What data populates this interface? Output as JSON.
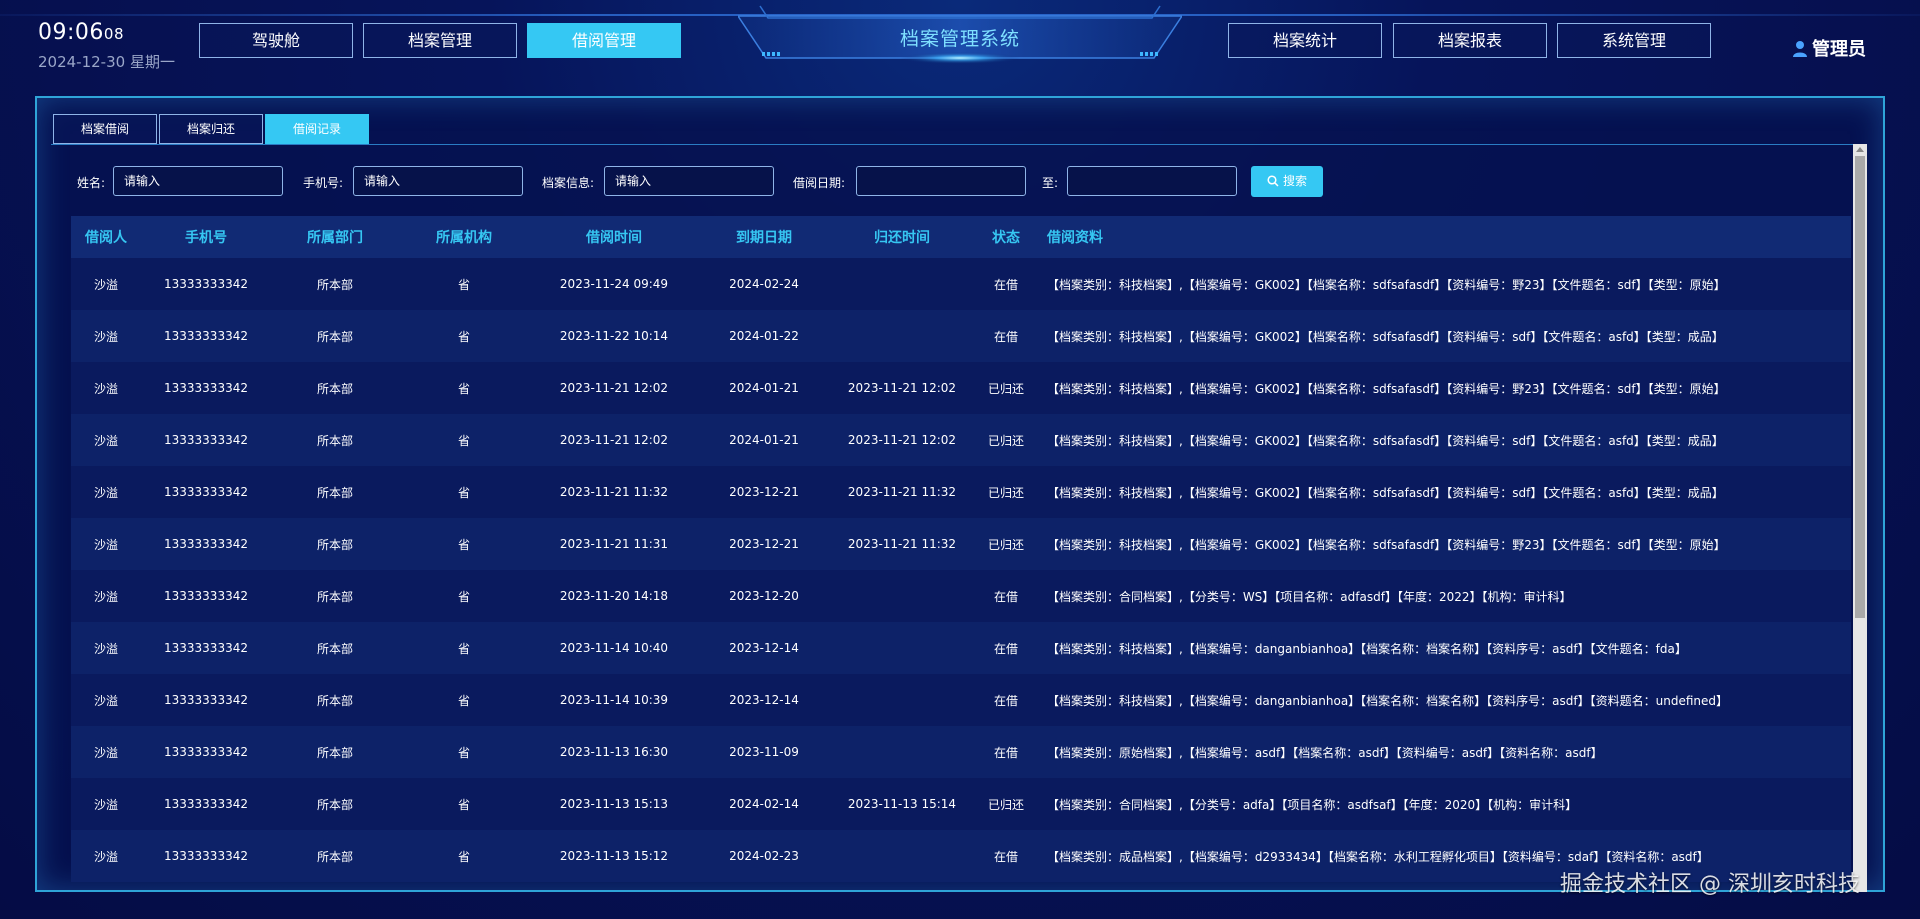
{
  "clock": {
    "time": "09:06",
    "seconds": "08",
    "date": "2024-12-30 星期一"
  },
  "nav_left": [
    {
      "label": "驾驶舱",
      "active": false
    },
    {
      "label": "档案管理",
      "active": false
    },
    {
      "label": "借阅管理",
      "active": true
    }
  ],
  "system_title": "档案管理系统",
  "nav_right": [
    {
      "label": "档案统计"
    },
    {
      "label": "档案报表"
    },
    {
      "label": "系统管理"
    }
  ],
  "user": {
    "name": "管理员",
    "icon": "user-icon"
  },
  "tabs": [
    {
      "label": "档案借阅",
      "active": false
    },
    {
      "label": "档案归还",
      "active": false
    },
    {
      "label": "借阅记录",
      "active": true
    }
  ],
  "filters": {
    "name_label": "姓名:",
    "name_placeholder": "请输入",
    "phone_label": "手机号:",
    "phone_placeholder": "请输入",
    "info_label": "档案信息:",
    "info_placeholder": "请输入",
    "date_label": "借阅日期:",
    "to_label": "至:",
    "search_label": "搜索",
    "search_icon": "search-icon"
  },
  "table": {
    "columns": [
      "借阅人",
      "手机号",
      "所属部门",
      "所属机构",
      "借阅时间",
      "到期日期",
      "归还时间",
      "状态",
      "借阅资料"
    ],
    "rows": [
      [
        "沙溢",
        "13333333342",
        "所本部",
        "省",
        "2023-11-24 09:49",
        "2024-02-24",
        "",
        "在借",
        "【档案类别：科技档案】,【档案编号：GK002】【档案名称：sdfsafasdf】【资料编号：野23】【文件题名：sdf】【类型：原始】"
      ],
      [
        "沙溢",
        "13333333342",
        "所本部",
        "省",
        "2023-11-22 10:14",
        "2024-01-22",
        "",
        "在借",
        "【档案类别：科技档案】,【档案编号：GK002】【档案名称：sdfsafasdf】【资料编号：sdf】【文件题名：asfd】【类型：成品】"
      ],
      [
        "沙溢",
        "13333333342",
        "所本部",
        "省",
        "2023-11-21 12:02",
        "2024-01-21",
        "2023-11-21 12:02",
        "已归还",
        "【档案类别：科技档案】,【档案编号：GK002】【档案名称：sdfsafasdf】【资料编号：野23】【文件题名：sdf】【类型：原始】"
      ],
      [
        "沙溢",
        "13333333342",
        "所本部",
        "省",
        "2023-11-21 12:02",
        "2024-01-21",
        "2023-11-21 12:02",
        "已归还",
        "【档案类别：科技档案】,【档案编号：GK002】【档案名称：sdfsafasdf】【资料编号：sdf】【文件题名：asfd】【类型：成品】"
      ],
      [
        "沙溢",
        "13333333342",
        "所本部",
        "省",
        "2023-11-21 11:32",
        "2023-12-21",
        "2023-11-21 11:32",
        "已归还",
        "【档案类别：科技档案】,【档案编号：GK002】【档案名称：sdfsafasdf】【资料编号：sdf】【文件题名：asfd】【类型：成品】"
      ],
      [
        "沙溢",
        "13333333342",
        "所本部",
        "省",
        "2023-11-21 11:31",
        "2023-12-21",
        "2023-11-21 11:32",
        "已归还",
        "【档案类别：科技档案】,【档案编号：GK002】【档案名称：sdfsafasdf】【资料编号：野23】【文件题名：sdf】【类型：原始】"
      ],
      [
        "沙溢",
        "13333333342",
        "所本部",
        "省",
        "2023-11-20 14:18",
        "2023-12-20",
        "",
        "在借",
        "【档案类别：合同档案】,【分类号：WS】【项目名称：adfasdf】【年度：2022】【机构：审计科】"
      ],
      [
        "沙溢",
        "13333333342",
        "所本部",
        "省",
        "2023-11-14 10:40",
        "2023-12-14",
        "",
        "在借",
        "【档案类别：科技档案】,【档案编号：danganbianhoa】【档案名称：档案名称】【资料序号：asdf】【文件题名：fda】"
      ],
      [
        "沙溢",
        "13333333342",
        "所本部",
        "省",
        "2023-11-14 10:39",
        "2023-12-14",
        "",
        "在借",
        "【档案类别：科技档案】,【档案编号：danganbianhoa】【档案名称：档案名称】【资料序号：asdf】【资料题名：undefined】"
      ],
      [
        "沙溢",
        "13333333342",
        "所本部",
        "省",
        "2023-11-13 16:30",
        "2023-11-09",
        "",
        "在借",
        "【档案类别：原始档案】,【档案编号：asdf】【档案名称：asdf】【资料编号：asdf】【资料名称：asdf】"
      ],
      [
        "沙溢",
        "13333333342",
        "所本部",
        "省",
        "2023-11-13 15:13",
        "2024-02-14",
        "2023-11-13 15:14",
        "已归还",
        "【档案类别：合同档案】,【分类号：adfa】【项目名称：asdfsaf】【年度：2020】【机构：审计科】"
      ],
      [
        "沙溢",
        "13333333342",
        "所本部",
        "省",
        "2023-11-13 15:12",
        "2024-02-23",
        "",
        "在借",
        "【档案类别：成品档案】,【档案编号：d2933434】【档案名称：水利工程孵化项目】【资料编号：sdaf】【资料名称：asdf】"
      ]
    ]
  },
  "watermark": "掘金技术社区 @ 深圳亥时科技",
  "colors": {
    "accent": "#35c8f3",
    "header_text": "#36c6f2",
    "background": "#06145a"
  }
}
